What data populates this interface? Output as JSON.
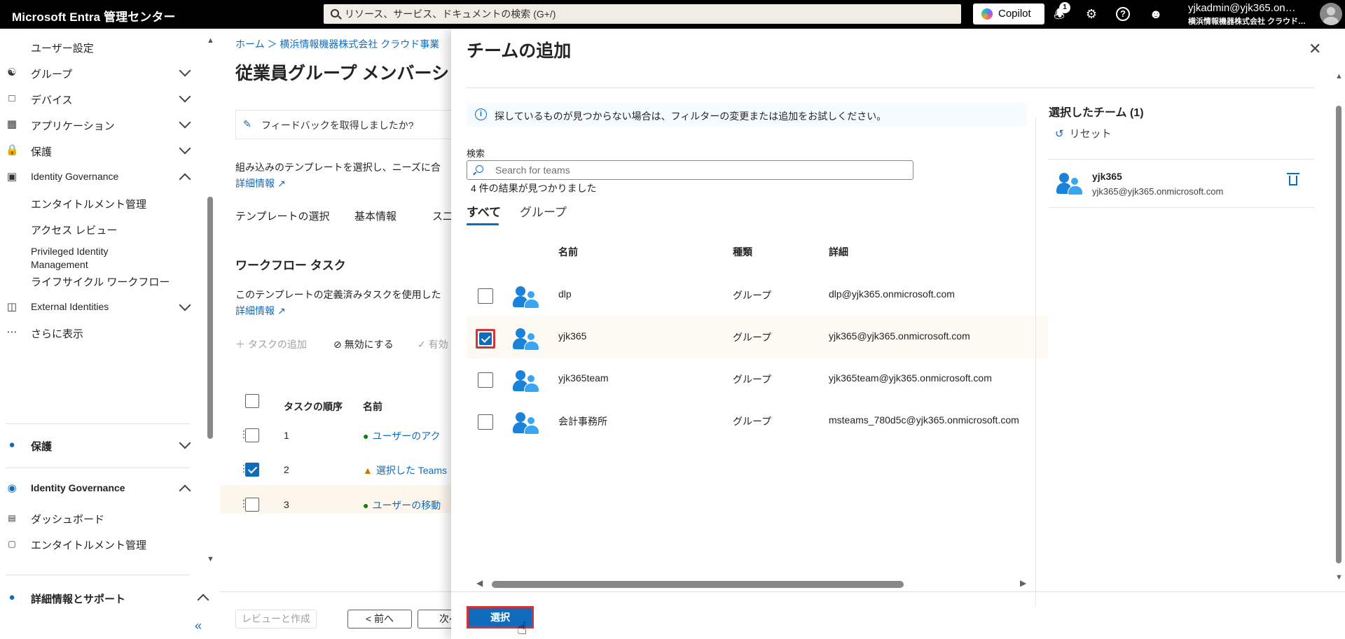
{
  "topbar": {
    "brand": "Microsoft Entra 管理センター",
    "search_placeholder": "リソース、サービス、ドキュメントの検索 (G+/)",
    "copilot_label": "Copilot",
    "notification_count": "1",
    "account_name": "yjkadmin@yjk365.on…",
    "account_org": "横浜情報機器株式会社 クラウド…"
  },
  "leftnav": {
    "items": [
      {
        "icon": "user-settings-icon",
        "label": "ユーザー設定"
      },
      {
        "icon": "group-icon",
        "label": "グループ"
      },
      {
        "icon": "device-icon",
        "label": "デバイス"
      },
      {
        "icon": "app-grid-icon",
        "label": "アプリケーション"
      },
      {
        "icon": "lock-icon",
        "label": "保護"
      },
      {
        "icon": "identity-governance-icon",
        "label": "Identity Governance"
      },
      {
        "label": "エンタイトルメント管理"
      },
      {
        "label": "アクセス レビュー"
      },
      {
        "label": "Privileged Identity Management"
      },
      {
        "label": "ライフサイクル ワークフロー"
      },
      {
        "icon": "external-identities-icon",
        "label": "External Identities"
      },
      {
        "icon": "more-icon",
        "label": "さらに表示"
      }
    ],
    "section_protect": "保護",
    "section_ig": "Identity Governance",
    "ig_items": [
      "ダッシュボード",
      "エンタイトルメント管理"
    ],
    "section_support": "詳細情報とサポート"
  },
  "bgpage": {
    "breadcrumb": "ホーム ＞ 横浜情報機器株式会社 クラウド事業",
    "title": "従業員グループ メンバーシップ",
    "feedback": "フィードバックを取得しましたか?",
    "intro_text": "組み込みのテンプレートを選択し、ニーズに合",
    "learn_more": "詳細情報",
    "tabs": [
      "テンプレートの選択",
      "基本情報",
      "ス二"
    ],
    "section_title": "ワークフロー タスク",
    "section_text": "このテンプレートの定義済みタスクを使用した",
    "learn_more2": "詳細情報",
    "toolbar": {
      "add_task": "タスクの追加",
      "disable": "無効にする",
      "enable": "有効"
    },
    "columns": {
      "order": "タスクの順序",
      "name": "名前"
    },
    "rows": [
      {
        "order": "1",
        "name": "ユーザーのアク",
        "status": "ok",
        "checked": false
      },
      {
        "order": "2",
        "name": "選択した Teams",
        "status": "warn",
        "checked": true
      },
      {
        "order": "3",
        "name": "ユーザーの移動",
        "status": "ok",
        "checked": false
      }
    ],
    "footer": {
      "review": "レビューと作成",
      "prev": "< 前へ",
      "next": "次へ"
    }
  },
  "panel": {
    "title": "チームの追加",
    "info": "探しているものが見つからない場合は、フィルターの変更または追加をお試しください。",
    "search_label": "検索",
    "search_placeholder": "Search for teams",
    "result_count": "4 件の結果が見つかりました",
    "tabs": [
      "すべて",
      "グループ"
    ],
    "columns": {
      "name": "名前",
      "type": "種類",
      "detail": "詳細"
    },
    "rows": [
      {
        "name": "dlp",
        "type": "グループ",
        "detail": "dlp@yjk365.onmicrosoft.com",
        "checked": false
      },
      {
        "name": "yjk365",
        "type": "グループ",
        "detail": "yjk365@yjk365.onmicrosoft.com",
        "checked": true
      },
      {
        "name": "yjk365team",
        "type": "グループ",
        "detail": "yjk365team@yjk365.onmicrosoft.com",
        "checked": false
      },
      {
        "name": "会計事務所",
        "type": "グループ",
        "detail": "msteams_780d5c@yjk365.onmicrosoft.com",
        "checked": false
      }
    ],
    "selected_title": "選択したチーム (1)",
    "reset_label": "リセット",
    "selected": {
      "name": "yjk365",
      "email": "yjk365@yjk365.onmicrosoft.com"
    },
    "select_button": "選択"
  },
  "colors": {
    "accent": "#0f6cbd",
    "highlight_border": "#d13438"
  }
}
